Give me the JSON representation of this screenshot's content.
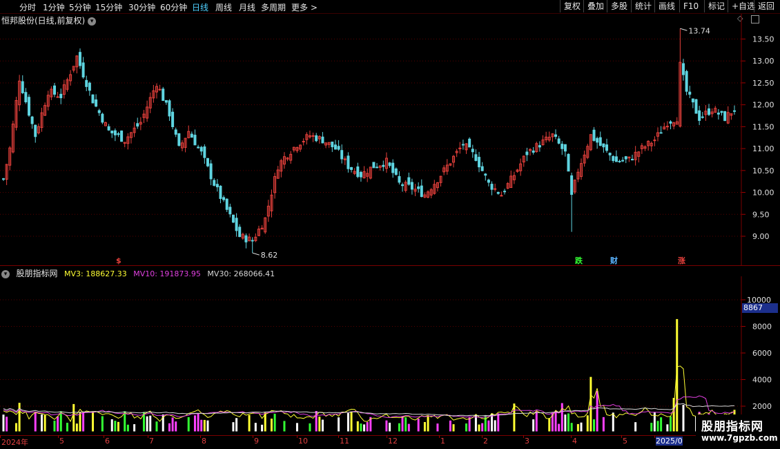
{
  "toolbar": {
    "periods": [
      "分时",
      "1分钟",
      "5分钟",
      "15分钟",
      "30分钟",
      "60分钟",
      "日线",
      "周线",
      "月线",
      "多周期",
      "更多"
    ],
    "active_index": 6,
    "more_arrow": ">",
    "buttons": [
      "复权",
      "叠加",
      "多股",
      "统计",
      "画线",
      "F10",
      "标记",
      "+自选",
      "返回"
    ]
  },
  "main_title": "恒邦股份(日线,前复权)",
  "indicator": {
    "name": "股朋指标网",
    "mv3_label": "MV3: 188627.33",
    "mv10_label": "MV10: 191873.95",
    "mv30_label": "MV30: 268066.41"
  },
  "colors": {
    "up": "#e8413c",
    "down": "#5fd4e0",
    "mv3": "#ffff33",
    "mv10": "#e040e0",
    "mv30": "#d8d8d8",
    "accent": "#1c2f8c"
  },
  "chart_data": [
    {
      "type": "candlestick",
      "title": "恒邦股份(日线,前复权)",
      "yticks": [
        "13.50",
        "13.00",
        "12.50",
        "12.00",
        "11.50",
        "11.00",
        "10.50",
        "10.00",
        "9.50",
        "9.00"
      ],
      "ylim": [
        8.4,
        14.0
      ],
      "annotations": [
        {
          "text": "13.74",
          "value": 13.74
        },
        {
          "text": "8.62",
          "value": 8.62
        }
      ],
      "event_markers": [
        "$",
        "跌",
        "财",
        "涨"
      ],
      "close_keypoints": [
        [
          0,
          10.3
        ],
        [
          2,
          11.0
        ],
        [
          5,
          12.6
        ],
        [
          10,
          11.3
        ],
        [
          14,
          12.3
        ],
        [
          18,
          12.2
        ],
        [
          23,
          13.1
        ],
        [
          28,
          12.1
        ],
        [
          33,
          11.4
        ],
        [
          38,
          11.2
        ],
        [
          43,
          11.6
        ],
        [
          48,
          12.5
        ],
        [
          52,
          11.8
        ],
        [
          55,
          11.0
        ],
        [
          58,
          11.4
        ],
        [
          62,
          10.9
        ],
        [
          66,
          10.2
        ],
        [
          70,
          9.6
        ],
        [
          74,
          9.0
        ],
        [
          78,
          8.9
        ],
        [
          82,
          9.4
        ],
        [
          86,
          10.6
        ],
        [
          88,
          10.8
        ],
        [
          92,
          11.1
        ],
        [
          96,
          11.3
        ],
        [
          100,
          11.2
        ],
        [
          104,
          11.0
        ],
        [
          108,
          10.6
        ],
        [
          112,
          10.4
        ],
        [
          116,
          10.6
        ],
        [
          120,
          10.7
        ],
        [
          124,
          10.2
        ],
        [
          128,
          10.1
        ],
        [
          132,
          9.95
        ],
        [
          136,
          10.3
        ],
        [
          140,
          10.7
        ],
        [
          144,
          11.1
        ],
        [
          148,
          10.8
        ],
        [
          152,
          10.2
        ],
        [
          156,
          9.95
        ],
        [
          160,
          10.4
        ],
        [
          164,
          10.9
        ],
        [
          168,
          11.1
        ],
        [
          172,
          11.3
        ],
        [
          176,
          10.9
        ],
        [
          178,
          9.9
        ],
        [
          180,
          10.5
        ],
        [
          184,
          11.3
        ],
        [
          188,
          11.0
        ],
        [
          192,
          10.7
        ],
        [
          196,
          10.75
        ],
        [
          200,
          11.0
        ],
        [
          204,
          11.2
        ],
        [
          208,
          11.6
        ],
        [
          211,
          11.7
        ],
        [
          212,
          12.9
        ],
        [
          214,
          12.3
        ],
        [
          218,
          11.7
        ],
        [
          222,
          11.9
        ],
        [
          226,
          11.7
        ],
        [
          229,
          11.9
        ]
      ],
      "x_labels": [
        "2024年",
        "5",
        "6",
        "7",
        "8",
        "9",
        "10",
        "11",
        "12",
        "1",
        "2",
        "3",
        "4",
        "5",
        "2025/0"
      ]
    },
    {
      "type": "bar",
      "title": "股朋指标网",
      "yticks": [
        "10000",
        "8000",
        "6000",
        "4000",
        "2000"
      ],
      "ylim": [
        0,
        12000
      ],
      "current_value": "8867",
      "series": [
        {
          "name": "MV3",
          "values_note": "volume moving average"
        },
        {
          "name": "MV10"
        },
        {
          "name": "MV30"
        }
      ]
    }
  ],
  "watermark": {
    "line1": "股朋指标网",
    "line2": "www.7gpzb.com"
  }
}
